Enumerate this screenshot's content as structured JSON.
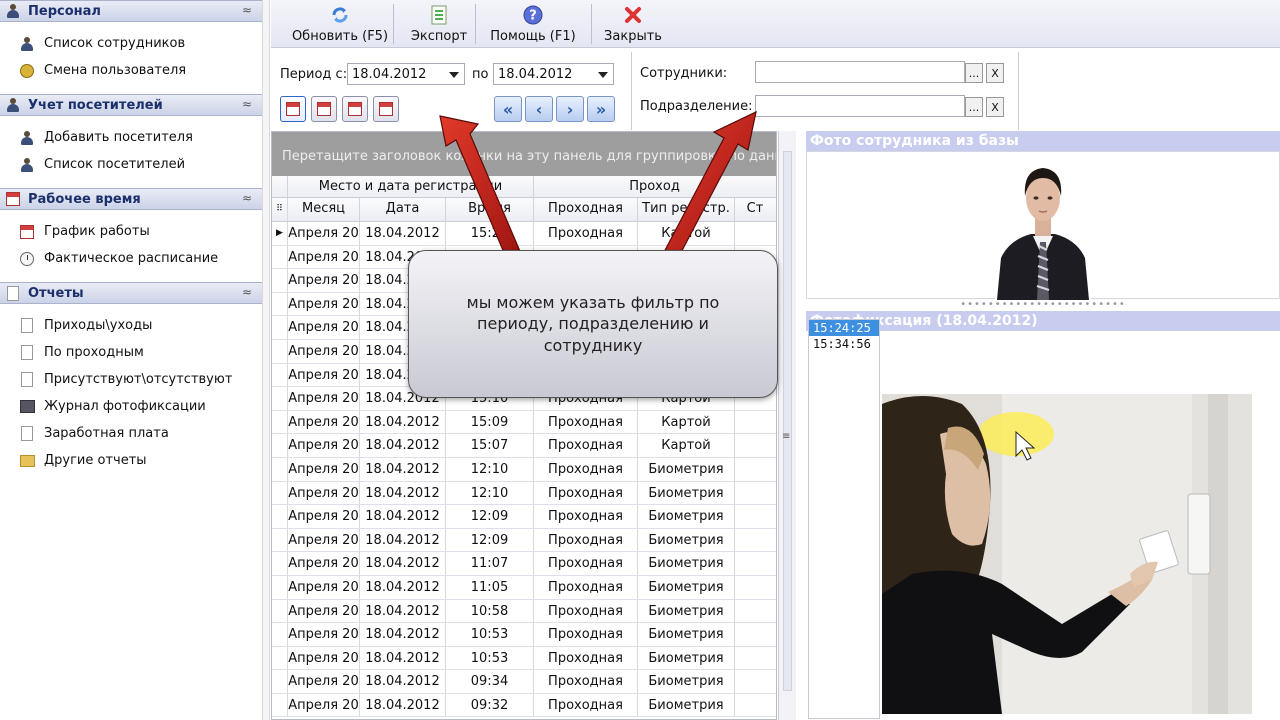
{
  "sidebar": {
    "groups": [
      {
        "title": "Персонал",
        "items": [
          "Список сотрудников",
          "Смена пользователя"
        ]
      },
      {
        "title": "Учет посетителей",
        "items": [
          "Добавить посетителя",
          "Список посетителей"
        ]
      },
      {
        "title": "Рабочее время",
        "items": [
          "График работы",
          "Фактическое расписание"
        ]
      },
      {
        "title": "Отчеты",
        "items": [
          "Приходы\\уходы",
          "По проходным",
          "Присутствуют\\отсутствуют",
          "Журнал фотофиксации",
          "Заработная плата",
          "Другие отчеты"
        ]
      }
    ],
    "collapse_glyph": "≈"
  },
  "toolbar": {
    "refresh": "Обновить (F5)",
    "export": "Экспорт",
    "help": "Помощь (F1)",
    "close": "Закрыть"
  },
  "filter": {
    "period_from_label": "Период с:",
    "period_from_value": "18.04.2012",
    "period_to_label": "по",
    "period_to_value": "18.04.2012",
    "employees_label": "Сотрудники:",
    "department_label": "Подразделение:",
    "browse_label": "...",
    "clear_label": "X"
  },
  "grid": {
    "group_panel_text": "Перетащите заголовок колонки на эту панель для группировки по данным",
    "bands": [
      "Место и дата регистрации",
      "Проход"
    ],
    "columns": [
      "Месяц",
      "Дата",
      "Время",
      "Проходная",
      "Тип регистр.",
      "Ст"
    ],
    "rows": [
      [
        "Апреля 20",
        "18.04.2012",
        "15:24",
        "Проходная",
        "Картой"
      ],
      [
        "Апреля 20",
        "18.04.2012",
        "",
        "",
        ""
      ],
      [
        "Апреля 20",
        "18.04.2012",
        "",
        "",
        ""
      ],
      [
        "Апреля 20",
        "18.04.2012",
        "",
        "",
        ""
      ],
      [
        "Апреля 20",
        "18.04.2012",
        "",
        "",
        ""
      ],
      [
        "Апреля 20",
        "18.04.2012",
        "",
        "",
        ""
      ],
      [
        "Апреля 20",
        "18.04.2012",
        "",
        "",
        ""
      ],
      [
        "Апреля 20",
        "18.04.2012",
        "15:10",
        "Проходная",
        "Картой"
      ],
      [
        "Апреля 20",
        "18.04.2012",
        "15:09",
        "Проходная",
        "Картой"
      ],
      [
        "Апреля 20",
        "18.04.2012",
        "15:07",
        "Проходная",
        "Картой"
      ],
      [
        "Апреля 20",
        "18.04.2012",
        "12:10",
        "Проходная",
        "Биометрия"
      ],
      [
        "Апреля 20",
        "18.04.2012",
        "12:10",
        "Проходная",
        "Биометрия"
      ],
      [
        "Апреля 20",
        "18.04.2012",
        "12:09",
        "Проходная",
        "Биометрия"
      ],
      [
        "Апреля 20",
        "18.04.2012",
        "12:09",
        "Проходная",
        "Биометрия"
      ],
      [
        "Апреля 20",
        "18.04.2012",
        "11:07",
        "Проходная",
        "Биометрия"
      ],
      [
        "Апреля 20",
        "18.04.2012",
        "11:05",
        "Проходная",
        "Биометрия"
      ],
      [
        "Апреля 20",
        "18.04.2012",
        "10:58",
        "Проходная",
        "Биометрия"
      ],
      [
        "Апреля 20",
        "18.04.2012",
        "10:53",
        "Проходная",
        "Биометрия"
      ],
      [
        "Апреля 20",
        "18.04.2012",
        "10:53",
        "Проходная",
        "Биометрия"
      ],
      [
        "Апреля 20",
        "18.04.2012",
        "09:34",
        "Проходная",
        "Биометрия"
      ],
      [
        "Апреля 20",
        "18.04.2012",
        "09:32",
        "Проходная",
        "Биометрия"
      ]
    ]
  },
  "right_panel": {
    "photo_title": "Фото сотрудника из базы",
    "fixation_title": "Фотофиксация (18.04.2012)",
    "times": [
      "15:24:25",
      "15:34:56"
    ]
  },
  "callout": {
    "text": "мы можем указать фильтр по периоду, подразделению и сотруднику"
  },
  "colors": {
    "header_gradient_top": "#e9ecf6",
    "title_bar": "#c8cdf0",
    "selection": "#3d8fe0",
    "arrow": "#c41e1e",
    "group_panel": "#9e9e9e"
  }
}
